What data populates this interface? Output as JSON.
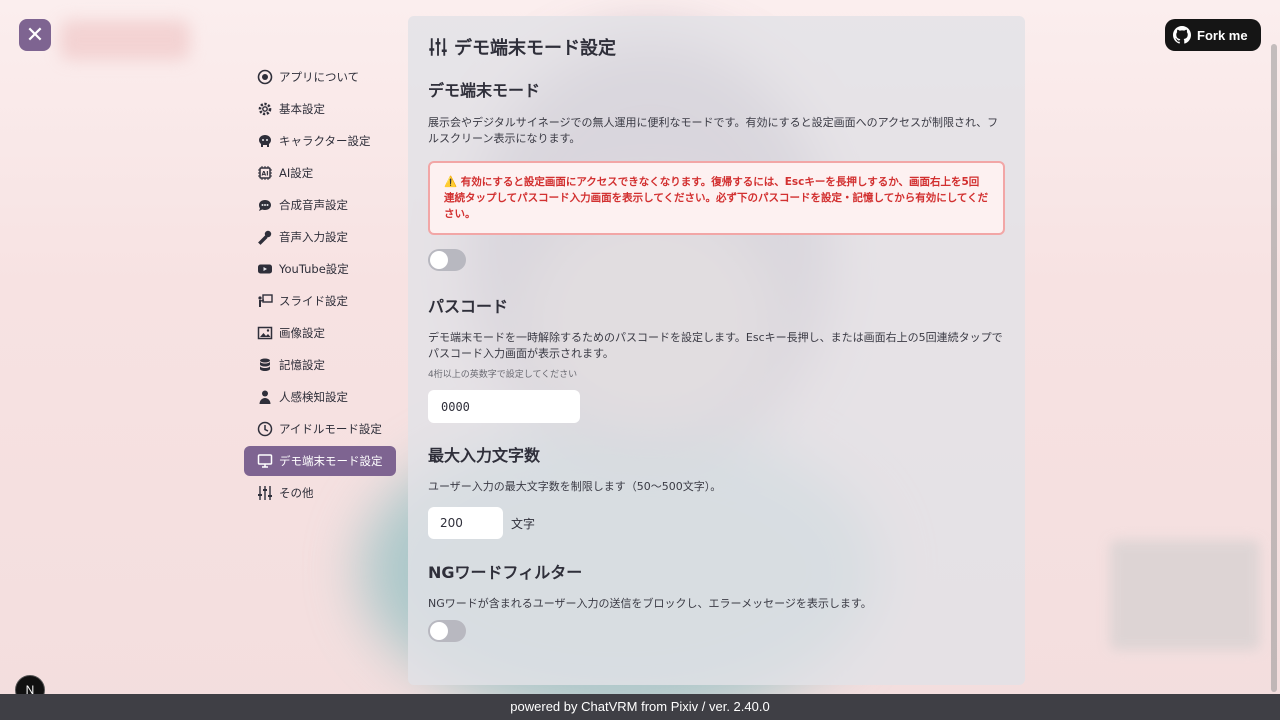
{
  "close_button": {
    "icon": "close-icon",
    "glyph": "✕"
  },
  "fork_button": {
    "label": "Fork me",
    "icon": "github-icon"
  },
  "sidebar": {
    "items": [
      {
        "label": "アプリについて",
        "icon": "info-icon",
        "active": false
      },
      {
        "label": "基本設定",
        "icon": "gear-icon",
        "active": false
      },
      {
        "label": "キャラクター設定",
        "icon": "character-icon",
        "active": false
      },
      {
        "label": "AI設定",
        "icon": "ai-chip-icon",
        "active": false
      },
      {
        "label": "合成音声設定",
        "icon": "speech-bubble-icon",
        "active": false
      },
      {
        "label": "音声入力設定",
        "icon": "microphone-icon",
        "active": false
      },
      {
        "label": "YouTube設定",
        "icon": "youtube-icon",
        "active": false
      },
      {
        "label": "スライド設定",
        "icon": "presentation-icon",
        "active": false
      },
      {
        "label": "画像設定",
        "icon": "image-icon",
        "active": false
      },
      {
        "label": "記憶設定",
        "icon": "database-icon",
        "active": false
      },
      {
        "label": "人感検知設定",
        "icon": "person-icon",
        "active": false
      },
      {
        "label": "アイドルモード設定",
        "icon": "clock-icon",
        "active": false
      },
      {
        "label": "デモ端末モード設定",
        "icon": "monitor-icon",
        "active": true
      },
      {
        "label": "その他",
        "icon": "sliders-icon",
        "active": false
      }
    ]
  },
  "panel": {
    "title": "デモ端末モード設定",
    "title_icon": "sliders-icon",
    "demo_mode": {
      "heading": "デモ端末モード",
      "description": "展示会やデジタルサイネージでの無人運用に便利なモードです。有効にすると設定画面へのアクセスが制限され、フルスクリーン表示になります。",
      "warning": "⚠️ 有効にすると設定画面にアクセスできなくなります。復帰するには、Escキーを長押しするか、画面右上を5回連続タップしてパスコード入力画面を表示してください。必ず下のパスコードを設定・記憶してから有効にしてください。",
      "enabled": false
    },
    "passcode": {
      "heading": "パスコード",
      "description": "デモ端末モードを一時解除するためのパスコードを設定します。Escキー長押し、または画面右上の5回連続タップでパスコード入力画面が表示されます。",
      "hint": "4桁以上の英数字で設定してください",
      "value": "0000"
    },
    "max_chars": {
      "heading": "最大入力文字数",
      "description": "ユーザー入力の最大文字数を制限します（50〜500文字）。",
      "value": "200",
      "unit": "文字"
    },
    "ng_filter": {
      "heading": "NGワードフィルター",
      "description": "NGワードが含まれるユーザー入力の送信をブロックし、エラーメッセージを表示します。",
      "enabled": false
    }
  },
  "footer": {
    "text": "powered by ChatVRM from Pixiv / ver. 2.40.0"
  },
  "n_badge": {
    "label": "N"
  },
  "colors": {
    "accent": "#7e6491",
    "warning": "#d23030",
    "footer_bg": "#3f3f45"
  }
}
